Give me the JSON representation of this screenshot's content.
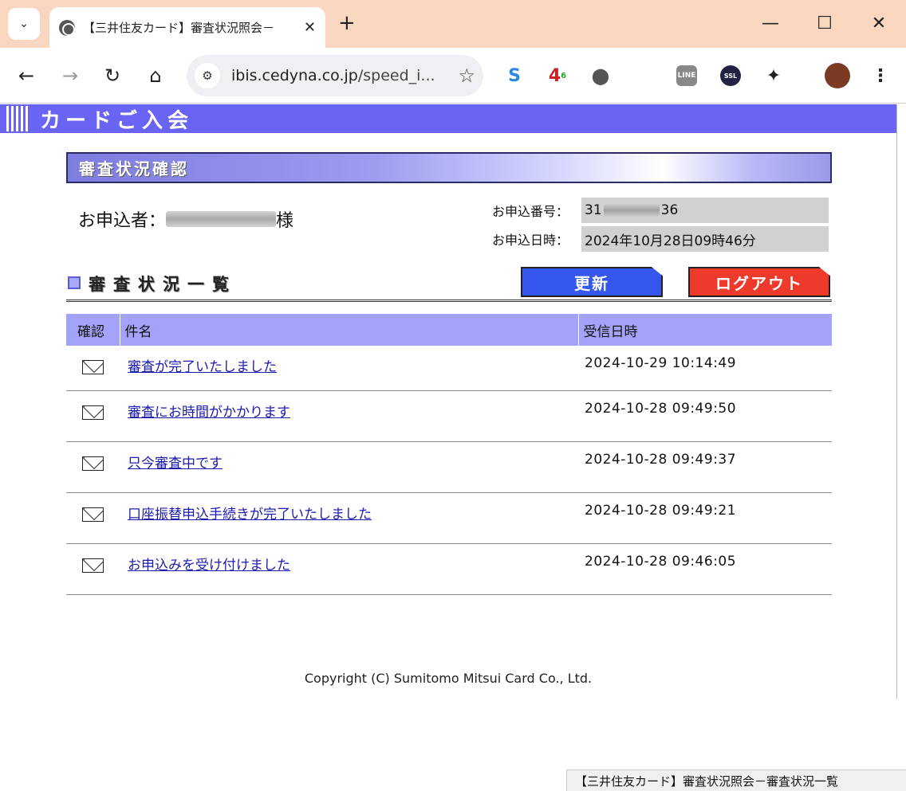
{
  "browser": {
    "tab_title": "【三井住友カード】審査状況照会－",
    "url_host": "ibis.cedyna.co.jp",
    "url_path": "/speed_i...",
    "status_text": "【三井住友カード】審査状況照会－審査状況一覧",
    "ext_badge_number": "4",
    "ext_badge_sup": "6"
  },
  "page": {
    "banner_title": "カードご入会",
    "section_title": "審査状況確認",
    "applicant_label": "お申込者：",
    "applicant_suffix": "様",
    "application_number_label": "お申込番号：",
    "application_number_prefix": "31",
    "application_number_suffix": "36",
    "application_date_label": "お申込日時：",
    "application_date_value": "2024年10月28日09時46分",
    "list_title": "審査状況一覧",
    "update_button": "更新",
    "logout_button": "ログアウト",
    "table_headers": [
      "確認",
      "件名",
      "受信日時"
    ],
    "rows": [
      {
        "subject": "審査が完了いたしました",
        "date": "2024-10-29 10:14:49"
      },
      {
        "subject": "審査にお時間がかかります",
        "date": "2024-10-28 09:49:50"
      },
      {
        "subject": "只今審査中です",
        "date": "2024-10-28 09:49:37"
      },
      {
        "subject": "口座振替申込手続きが完了いたしました",
        "date": "2024-10-28 09:49:21"
      },
      {
        "subject": "お申込みを受け付けました",
        "date": "2024-10-28 09:46:05"
      }
    ],
    "copyright": "Copyright (C) Sumitomo Mitsui Card Co., Ltd."
  }
}
